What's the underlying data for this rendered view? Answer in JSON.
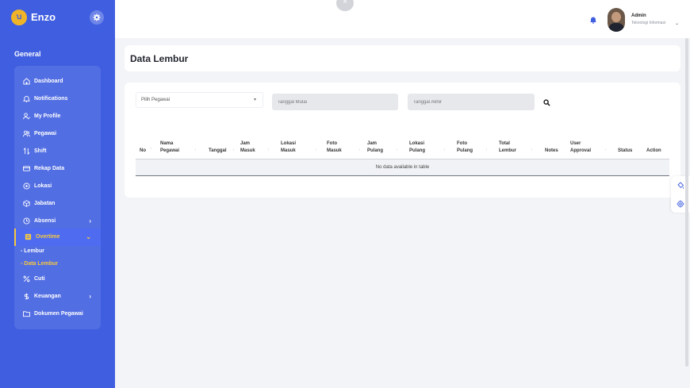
{
  "brand": {
    "name": "Enzo",
    "logo_text": "ꭒ"
  },
  "sidebar": {
    "section": "General",
    "items": [
      {
        "label": "Dashboard",
        "icon": "home-icon"
      },
      {
        "label": "Notifications",
        "icon": "bell-outline-icon"
      },
      {
        "label": "My Profile",
        "icon": "user-edit-icon"
      },
      {
        "label": "Pegawai",
        "icon": "users-icon"
      },
      {
        "label": "Shift",
        "icon": "swap-icon"
      },
      {
        "label": "Rekap Data",
        "icon": "card-icon"
      },
      {
        "label": "Lokasi",
        "icon": "location-icon"
      },
      {
        "label": "Jabatan",
        "icon": "box-icon"
      },
      {
        "label": "Absensi",
        "icon": "clock-icon",
        "chevron": "›"
      },
      {
        "label": "Overtime",
        "icon": "overtime-icon",
        "chevron": "⌄"
      },
      {
        "label": "Cuti",
        "icon": "percent-icon"
      },
      {
        "label": "Keuangan",
        "icon": "dollar-icon",
        "chevron": "›"
      },
      {
        "label": "Dokumen Pegawai",
        "icon": "folder-icon"
      }
    ],
    "submenu": [
      {
        "label": "- Lembur"
      },
      {
        "label": "- Data Lembur"
      }
    ]
  },
  "topbar": {
    "close_glyph": "×",
    "user_name": "Admin",
    "user_role": "Teknologi Informasi",
    "user_chevron": "⌄"
  },
  "page": {
    "title": "Data Lembur"
  },
  "filters": {
    "pegawai_placeholder": "Pilih Pegawai",
    "pegawai_chevron": "▾",
    "start_placeholder": "Tanggal Mulai",
    "end_placeholder": "Tanggal Akhir"
  },
  "table": {
    "columns": [
      {
        "line1": "No",
        "line2": ""
      },
      {
        "line1": "Nama",
        "line2": "Pegawai"
      },
      {
        "line1": "Tanggal",
        "line2": ""
      },
      {
        "line1": "Jam",
        "line2": "Masuk"
      },
      {
        "line1": "Lokasi",
        "line2": "Masuk"
      },
      {
        "line1": "Foto",
        "line2": "Masuk"
      },
      {
        "line1": "Jam",
        "line2": "Pulang"
      },
      {
        "line1": "Lokasi",
        "line2": "Pulang"
      },
      {
        "line1": "Foto",
        "line2": "Pulang"
      },
      {
        "line1": "Total",
        "line2": "Lembur"
      },
      {
        "line1": "Notes",
        "line2": ""
      },
      {
        "line1": "User",
        "line2": "Approval"
      },
      {
        "line1": "Status",
        "line2": ""
      },
      {
        "line1": "Action",
        "line2": ""
      }
    ],
    "sort_glyph": "↕",
    "empty_message": "No data available in table"
  },
  "colors": {
    "sidebar": "#3f5ee0",
    "accent": "#f6c83f",
    "background": "#f3f4f7"
  }
}
